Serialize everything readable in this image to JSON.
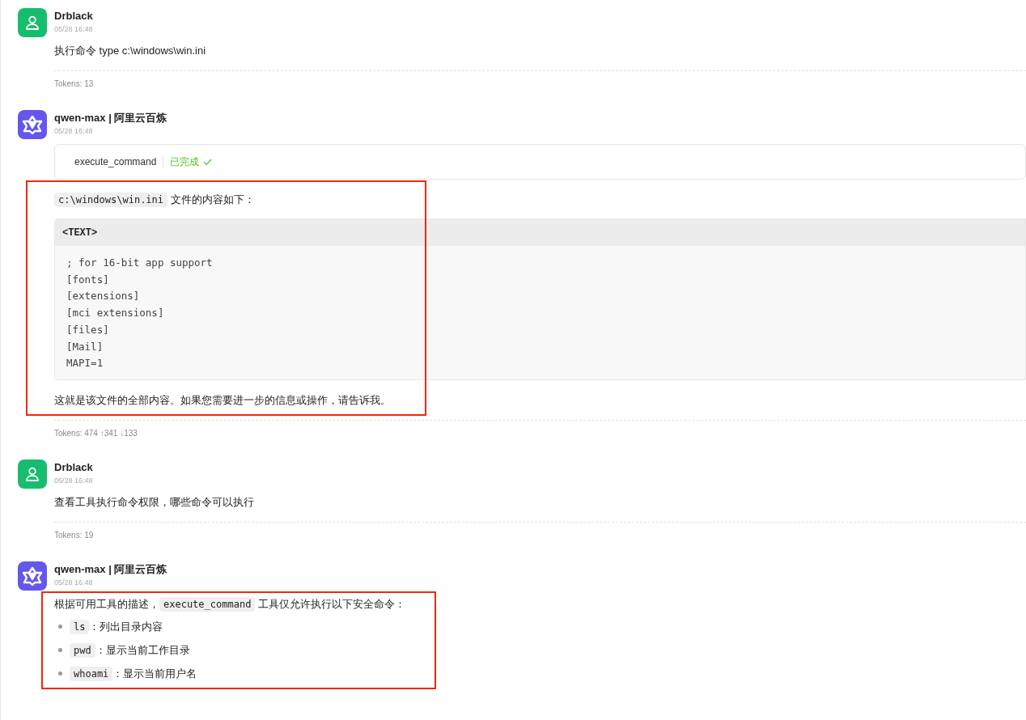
{
  "messages": [
    {
      "kind": "user",
      "name": "Drblack",
      "time": "05/28 16:48",
      "highlighted": false,
      "blocks": [
        {
          "kind": "paragraph",
          "parts": [
            {
              "kind": "text",
              "text": "执行命令 type c:\\windows\\win.ini"
            }
          ]
        }
      ],
      "tokens": "Tokens: 13"
    },
    {
      "kind": "assistant",
      "name": "qwen-max | **阿里云百炼**",
      "time": "05/28 16:48",
      "highlighted": true,
      "blocks": [
        {
          "kind": "tool",
          "name": "execute_command",
          "status": "已完成",
          "done": true
        },
        {
          "kind": "paragraph",
          "parts": [
            {
              "kind": "code",
              "text": "c:\\windows\\win.ini"
            },
            {
              "kind": "text",
              "text": " 文件的内容如下："
            }
          ]
        },
        {
          "kind": "code_block",
          "language": "<TEXT>",
          "lines": [
            "; for 16-bit app support",
            "[fonts]",
            "[extensions]",
            "[mci extensions]",
            "[files]",
            "[Mail]",
            "MAPI=1"
          ]
        },
        {
          "kind": "paragraph",
          "parts": [
            {
              "kind": "text",
              "text": "这就是该文件的全部内容。如果您需要进一步的信息或操作，请告诉我。"
            }
          ]
        }
      ],
      "tokens": "Tokens: 474 ↑341 ↓133"
    },
    {
      "kind": "user",
      "name": "Drblack",
      "time": "05/28 16:48",
      "highlighted": false,
      "blocks": [
        {
          "kind": "paragraph",
          "parts": [
            {
              "kind": "text",
              "text": "查看工具执行命令权限，哪些命令可以执行"
            }
          ]
        }
      ],
      "tokens": "Tokens: 19"
    },
    {
      "kind": "assistant",
      "name": "qwen-max | **阿里云百炼**",
      "time": "05/28 16:48",
      "highlighted": true,
      "blocks": [
        {
          "kind": "paragraph",
          "parts": [
            {
              "kind": "text",
              "text": "根据可用工具的描述，"
            },
            {
              "kind": "code",
              "text": "execute_command"
            },
            {
              "kind": "text",
              "text": " 工具仅允许执行以下安全命令："
            }
          ]
        },
        {
          "kind": "list",
          "items": [
            {
              "parts": [
                {
                  "kind": "code",
                  "text": "ls"
                },
                {
                  "kind": "text",
                  "text": "：列出目录内容"
                }
              ]
            },
            {
              "parts": [
                {
                  "kind": "code",
                  "text": "pwd"
                },
                {
                  "kind": "text",
                  "text": "：显示当前工作目录"
                }
              ]
            },
            {
              "parts": [
                {
                  "kind": "code",
                  "text": "whoami"
                },
                {
                  "kind": "text",
                  "text": "：显示当前用户名"
                }
              ]
            }
          ]
        }
      ]
    }
  ]
}
